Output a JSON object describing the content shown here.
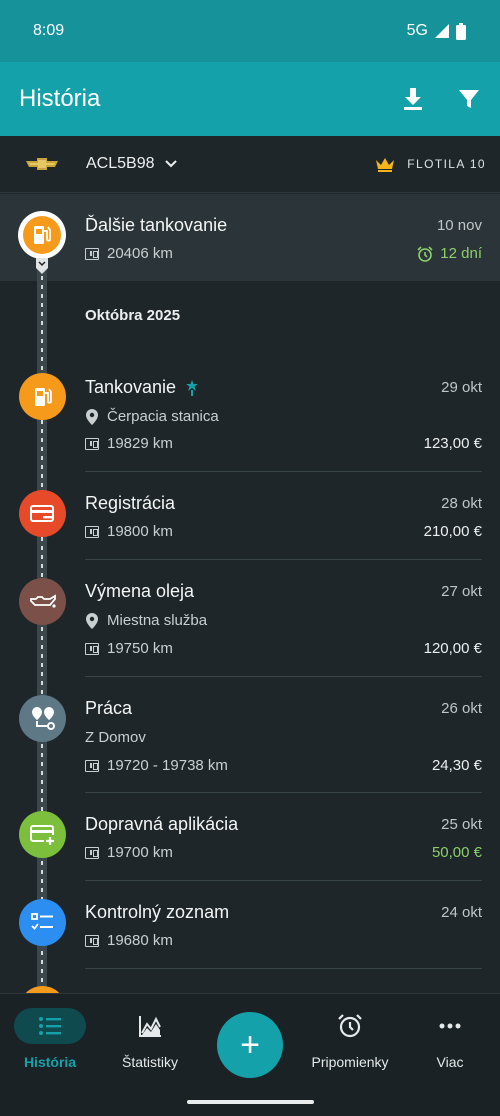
{
  "status_bar": {
    "time": "8:09",
    "network": "5G"
  },
  "app_bar": {
    "title": "História",
    "download_icon": "download-icon",
    "filter_icon": "filter-icon"
  },
  "vehicle": {
    "plate": "ACL5B98",
    "fleet_label": "FLOTILA 10",
    "brand_icon": "chevrolet-logo",
    "fleet_icon": "crown-icon"
  },
  "next_refuel": {
    "title": "Ďalšie tankovanie",
    "date": "10 nov",
    "odometer": "20406 km",
    "remaining": "12 dní",
    "icon": "fuel-pump-icon",
    "color": "#f59a1b",
    "remaining_color": "#8ccf6a"
  },
  "month_header": "Októbra 2025",
  "entries": [
    {
      "title": "Tankovanie",
      "date": "29 okt",
      "place": "Čerpacia stanica",
      "odometer": "19829 km",
      "amount": "123,00 €",
      "icon": "fuel-pump-icon",
      "color": "#f59a1b"
    },
    {
      "title": "Registrácia",
      "date": "28 okt",
      "odometer": "19800 km",
      "amount": "210,00 €",
      "icon": "card-minus-icon",
      "color": "#e64a28"
    },
    {
      "title": "Výmena oleja",
      "date": "27 okt",
      "place": "Miestna služba",
      "odometer": "19750 km",
      "amount": "120,00 €",
      "icon": "oil-can-icon",
      "color": "#7a5048"
    },
    {
      "title": "Práca",
      "date": "26 okt",
      "place": "Z Domov",
      "odometer": "19720 - 19738 km",
      "amount": "24,30 €",
      "icon": "route-icon",
      "color": "#5e7886"
    },
    {
      "title": "Dopravná aplikácia",
      "date": "25 okt",
      "odometer": "19700 km",
      "amount": "50,00 €",
      "icon": "card-plus-icon",
      "color": "#7bbf3c",
      "amount_color": "#8ccf6a"
    },
    {
      "title": "Kontrolný zoznam",
      "date": "24 okt",
      "odometer": "19680 km",
      "icon": "checklist-icon",
      "color": "#2b8ef0"
    }
  ],
  "bottom_nav": {
    "items": [
      {
        "label": "História",
        "icon": "list-icon"
      },
      {
        "label": "Štatistiky",
        "icon": "chart-icon"
      },
      {
        "label": "Pripomienky",
        "icon": "alarm-icon"
      },
      {
        "label": "Viac",
        "icon": "more-icon"
      }
    ],
    "fab": "+"
  }
}
